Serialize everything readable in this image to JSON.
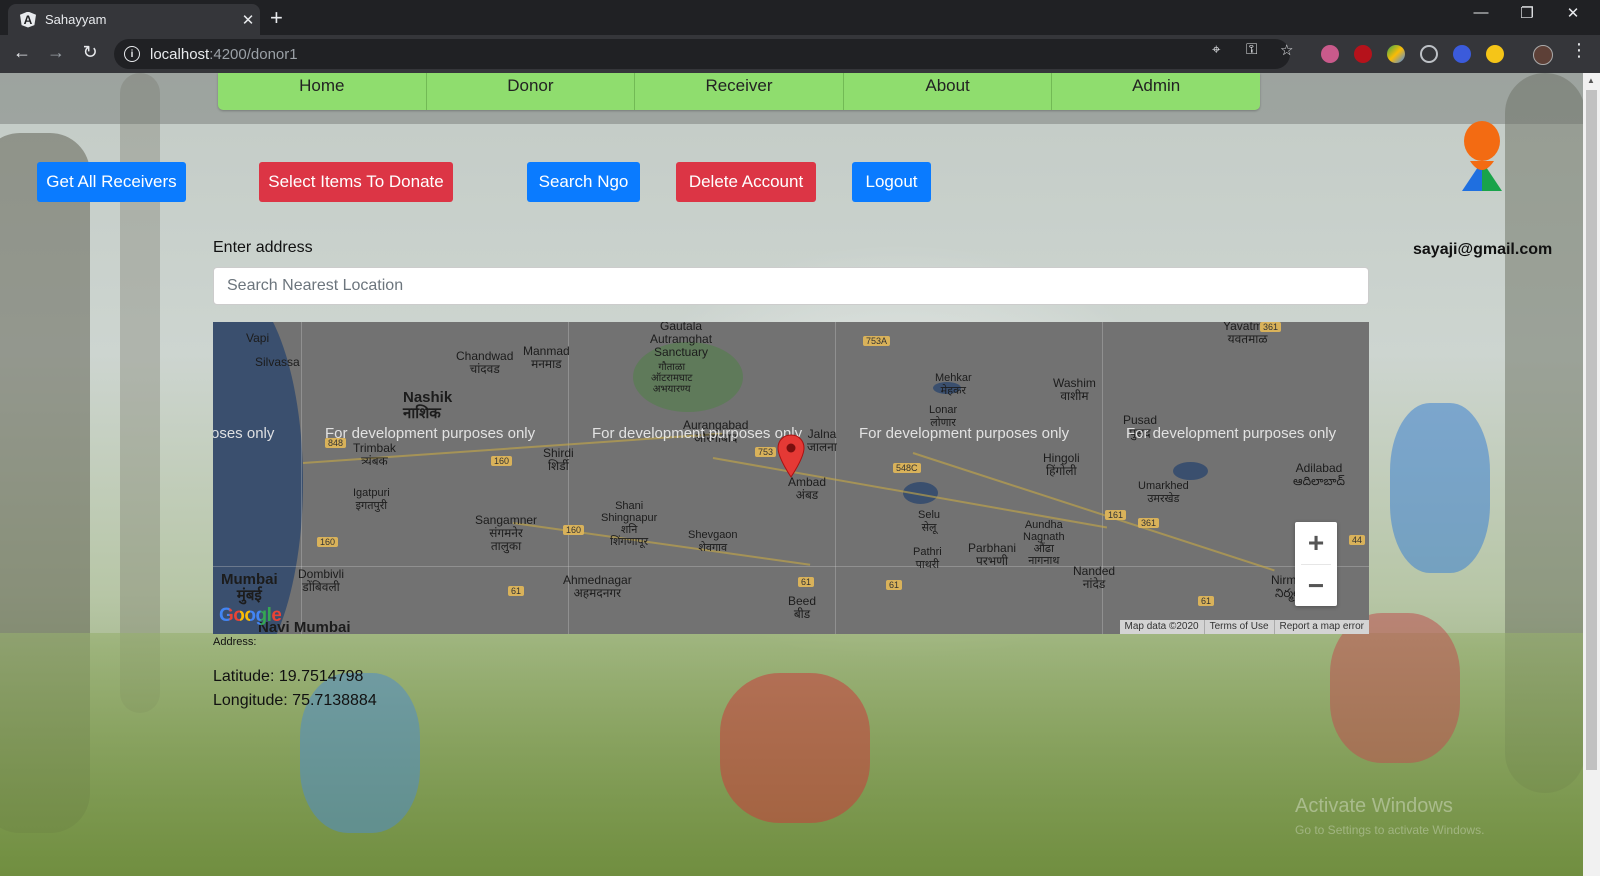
{
  "browser": {
    "tab_title": "Sahayyam",
    "tab_close": "✕",
    "new_tab": "+",
    "url_host": "localhost",
    "url_rest": ":4200/donor1",
    "controls": {
      "minimize": "—",
      "maximize": "❐",
      "close": "✕"
    }
  },
  "nav": {
    "items": [
      "Home",
      "Donor",
      "Receiver",
      "About",
      "Admin"
    ]
  },
  "actions": {
    "get_all_receivers": "Get All Receivers",
    "select_items": "Select Items To Donate",
    "search_ngo": "Search Ngo",
    "delete_account": "Delete Account",
    "logout": "Logout"
  },
  "user": {
    "email": "sayaji@gmail.com"
  },
  "address": {
    "label": "Enter address",
    "placeholder": "Search Nearest Location"
  },
  "map": {
    "watermark": "For development purposes only",
    "watermark_partial": "oses only",
    "logo": "Google",
    "zoom_in": "+",
    "zoom_out": "−",
    "attribution": [
      "Map data ©2020",
      "Terms of Use",
      "Report a map error"
    ],
    "places": {
      "vapi": "Vapi",
      "silvassa": "Silvassa",
      "gautala": "Gautala\nAutramghat\nSanctuary",
      "gautala_local": "गौताळा\nऑटरामघाट\nअभयारण्य",
      "chandwad": "Chandwad\nचांदवड",
      "manmad": "Manmad\nमनमाड",
      "nashik": "Nashik",
      "nashik_local": "नाशिक",
      "trimbak": "Trimbak\nत्र्यंबक",
      "shirdi": "Shirdi\nशिर्डी",
      "aurangabad": "Aurangabad\nऔरंगाबाद",
      "jalna": "Jalna\nजालना",
      "ambad": "Ambad\nअंबड",
      "mehkar": "Mehkar\nमेहकर",
      "lonar": "Lonar\nलोणार",
      "washim": "Washim\nवाशीम",
      "yavatmal": "Yavatmal\nयवतमाळ",
      "pusad": "Pusad\nपुसद",
      "hingoli": "Hingoli\nहिंगोली",
      "umarkhed": "Umarkhed\nउमरखेड",
      "adilabad": "Adilabad\nఆదిలాబాద్",
      "igatpuri": "Igatpuri\nइगतपुरी",
      "sangamner": "Sangamner\nसंगमनेर\nतालुका",
      "shani": "Shani\nShingnapur\nशनि\nशिंगणापूर",
      "shevgaon": "Shevgaon\nशेवगाव",
      "selu": "Selu\nसेलू",
      "pathri": "Pathri\nपाथरी",
      "parbhani": "Parbhani\nपरभणी",
      "aundha": "Aundha\nNagnath\nऔंढा\nनागनाथ",
      "nanded": "Nanded\nनांदेड",
      "nirmal": "Nirmal\nనిర్మల్",
      "mumbai": "Mumbai\nमुंबई",
      "dombivli": "Dombivli\nडोंबिवली",
      "ahmednagar": "Ahmednagar\nअहमदनगर",
      "beed": "Beed\nबीड",
      "navi_mumbai": "Navi Mumbai",
      "jalna_top": "जालना"
    },
    "highways": [
      "753A",
      "848",
      "160",
      "160",
      "160",
      "753",
      "548C",
      "161",
      "361",
      "361",
      "61",
      "61",
      "61",
      "61",
      "44"
    ],
    "colors": {
      "water": "#3a4f6e",
      "land": "#727272",
      "forest": "#5f7a5a"
    }
  },
  "result": {
    "address_label": "Address:",
    "latitude": "Latitude: 19.7514798",
    "longitude": "Longitude: 75.7138884"
  },
  "os_watermark": {
    "line1": "Activate Windows",
    "line2": "Go to Settings to activate Windows."
  },
  "colors": {
    "nav_green": "#8fdd6e",
    "primary_blue": "#0a7bff",
    "danger_red": "#dc3545"
  }
}
